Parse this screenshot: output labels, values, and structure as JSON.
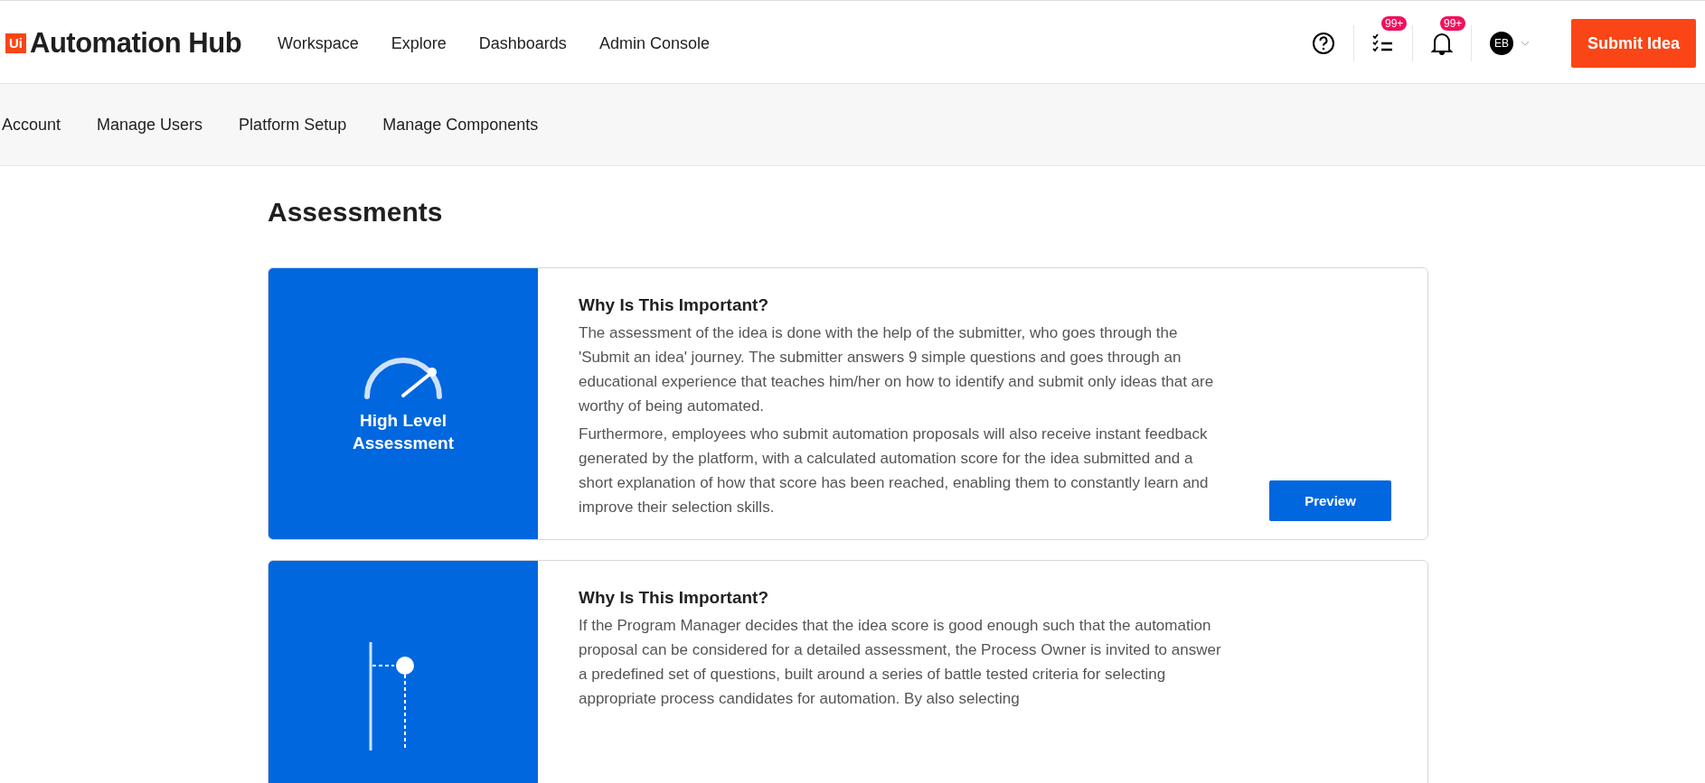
{
  "header": {
    "logo_badge": "Ui",
    "logo_text": "Automation Hub",
    "nav": [
      {
        "label": "Workspace",
        "selected": false
      },
      {
        "label": "Explore",
        "selected": false
      },
      {
        "label": "Dashboards",
        "selected": false
      },
      {
        "label": "Admin Console",
        "selected": false
      }
    ],
    "tasks_badge": "99+",
    "notifications_badge": "99+",
    "avatar": "EB",
    "submit_button": "Submit Idea"
  },
  "subnav": [
    {
      "label": "Account",
      "selected": false
    },
    {
      "label": "Manage Users",
      "selected": false
    },
    {
      "label": "Platform Setup",
      "selected": false
    },
    {
      "label": "Manage Components",
      "selected": false
    }
  ],
  "page_title": "Assessments",
  "cards": [
    {
      "kind": "gauge",
      "panel_title": "High Level Assessment",
      "heading": "Why Is This Important?",
      "paragraphs": [
        "The assessment of the idea is done with the help of the submitter, who goes through the 'Submit an idea' journey. The submitter answers 9 simple questions and goes through an educational experience that teaches him/her on how to identify and submit only ideas that are worthy of being automated.",
        "Furthermore, employees who submit automation proposals will also receive instant feedback generated by the platform, with a calculated automation score for the idea submitted and a short explanation of how that score has been reached, enabling them to constantly learn and improve their selection skills."
      ],
      "button": "Preview"
    },
    {
      "kind": "chart",
      "heading": "Why Is This Important?",
      "paragraphs": [
        "If the Program Manager decides that the idea score is good enough such that the automation proposal can be considered for a detailed assessment, the Process Owner is invited to answer a predefined set of questions, built around a series of battle tested criteria for selecting appropriate process candidates for automation. By also selecting"
      ]
    }
  ]
}
